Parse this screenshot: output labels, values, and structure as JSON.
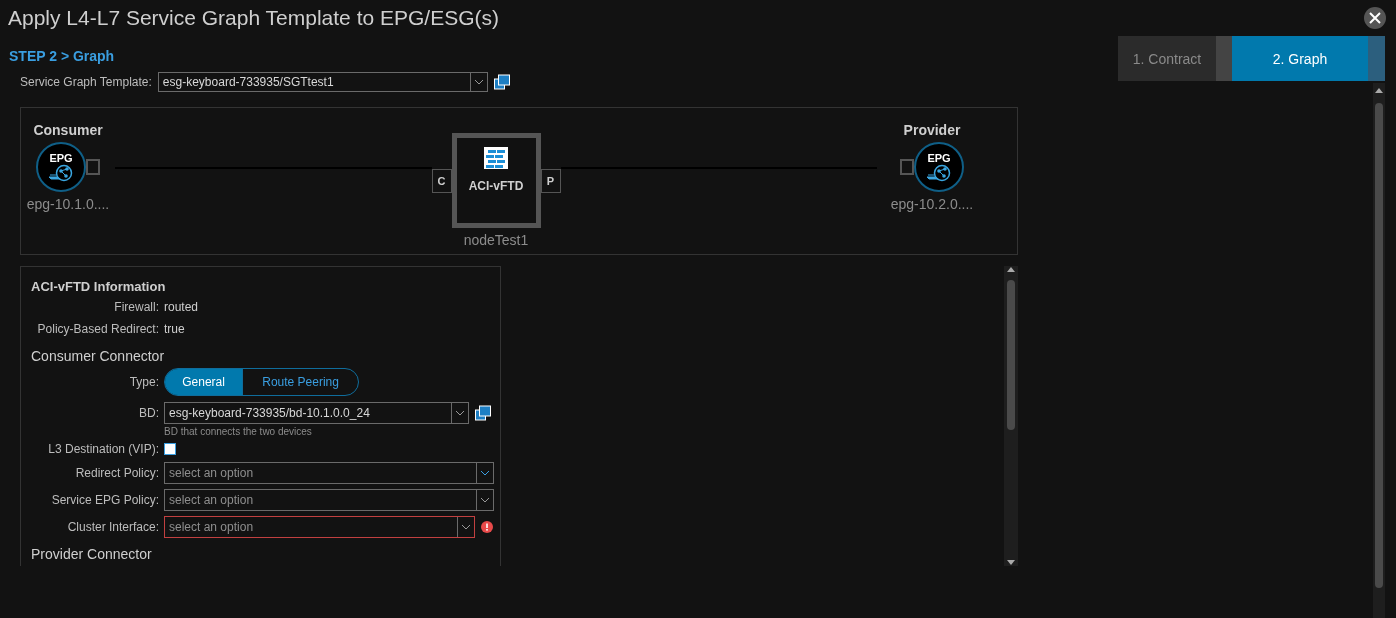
{
  "window": {
    "title": "Apply L4-L7 Service Graph Template to EPG/ESG(s)"
  },
  "step_label": "STEP 2 > Graph",
  "wizard_steps": [
    {
      "label": "1. Contract",
      "selected": false
    },
    {
      "label": "2. Graph",
      "selected": true
    }
  ],
  "template": {
    "label": "Service Graph Template:",
    "value": "esg-keyboard-733935/SGTtest1"
  },
  "graph": {
    "consumer": {
      "heading": "Consumer",
      "badge": "EPG",
      "name": "epg-10.1.0...."
    },
    "node": {
      "label": "ACI-vFTD",
      "name": "nodeTest1",
      "consumer_port": "C",
      "provider_port": "P"
    },
    "provider": {
      "heading": "Provider",
      "badge": "EPG",
      "name": "epg-10.2.0...."
    }
  },
  "info": {
    "title": "ACI-vFTD Information",
    "properties": [
      {
        "label": "Firewall:",
        "value": "routed"
      },
      {
        "label": "Policy-Based Redirect:",
        "value": "true"
      }
    ],
    "consumer_connector": {
      "heading": "Consumer Connector",
      "type": {
        "label": "Type:",
        "options": [
          {
            "label": "General",
            "selected": true
          },
          {
            "label": "Route Peering",
            "selected": false
          }
        ]
      },
      "bd": {
        "label": "BD:",
        "value": "esg-keyboard-733935/bd-10.1.0.0_24",
        "hint": "BD that connects the two devices"
      },
      "l3": {
        "label": "L3 Destination (VIP):",
        "checked": false
      },
      "selects": [
        {
          "label": "Redirect Policy:",
          "placeholder": "select an option",
          "error": false
        },
        {
          "label": "Service EPG Policy:",
          "placeholder": "select an option",
          "error": false
        },
        {
          "label": "Cluster Interface:",
          "placeholder": "select an option",
          "error": true
        }
      ]
    },
    "provider_connector": {
      "heading": "Provider Connector"
    }
  }
}
